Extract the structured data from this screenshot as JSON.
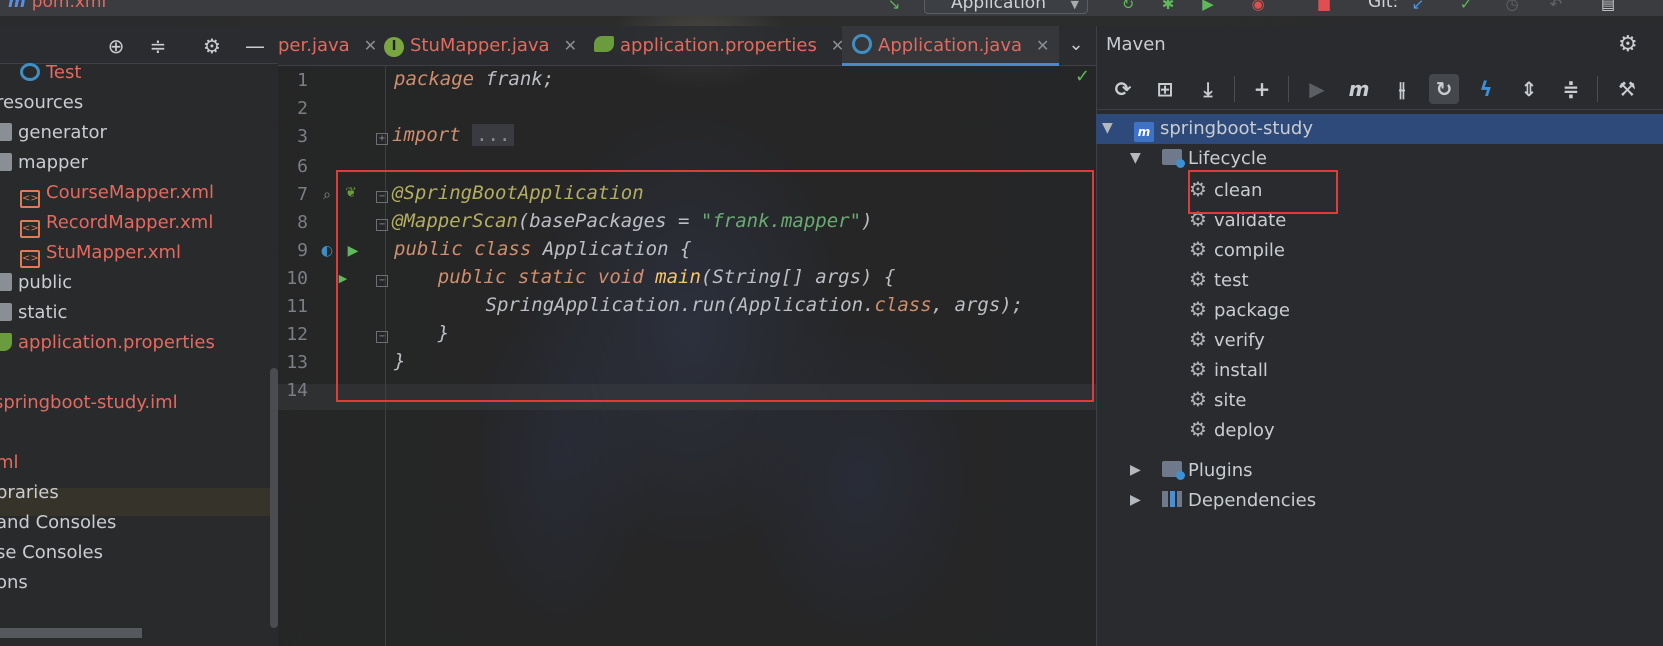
{
  "topbar": {
    "file_name": "pom.xml",
    "run_config": "Application",
    "git_label": "Git:"
  },
  "project": {
    "items": [
      {
        "label": "Test",
        "color": "red"
      },
      {
        "label": "resources",
        "color": "plain"
      },
      {
        "label": "generator",
        "color": "plain"
      },
      {
        "label": "mapper",
        "color": "plain"
      },
      {
        "label": "CourseMapper.xml",
        "color": "red"
      },
      {
        "label": "RecordMapper.xml",
        "color": "red"
      },
      {
        "label": "StuMapper.xml",
        "color": "red"
      },
      {
        "label": "public",
        "color": "plain"
      },
      {
        "label": "static",
        "color": "plain"
      },
      {
        "label": "application.properties",
        "color": "red"
      },
      {
        "label": "springboot-study.iml",
        "color": "red"
      },
      {
        "label": "ml",
        "color": "red"
      },
      {
        "label": "braries",
        "color": "plain"
      },
      {
        "label": "and Consoles",
        "color": "plain"
      },
      {
        "label": "se Consoles",
        "color": "plain"
      },
      {
        "label": "ons",
        "color": "plain"
      }
    ]
  },
  "tabs": [
    {
      "label": "per.java"
    },
    {
      "label": "StuMapper.java"
    },
    {
      "label": "application.properties"
    },
    {
      "label": "Application.java"
    }
  ],
  "editor": {
    "line_numbers": [
      "1",
      "2",
      "3",
      "6",
      "7",
      "8",
      "9",
      "10",
      "11",
      "12",
      "13",
      "14"
    ],
    "line1": {
      "kw": "package",
      "rest": " frank;"
    },
    "line3": {
      "kw": "import",
      "ellipsis": "..."
    },
    "line7": {
      "ann": "@SpringBootApplication"
    },
    "line8": {
      "ann": "@MapperScan",
      "open": "(",
      "param": "basePackages",
      "eq": " = ",
      "str": "\"frank.mapper\"",
      "close": ")"
    },
    "line9": {
      "kw": "public class",
      "rest": " Application {"
    },
    "line10": {
      "kw": "public static void",
      "meth": "main",
      "rest": "(String[] args) {"
    },
    "line11": {
      "pre": "SpringApplication.run(Application.",
      "kw": "class",
      "rest": ", args);"
    },
    "line12": {
      "text": "}"
    },
    "line13": {
      "text": "}"
    }
  },
  "maven": {
    "title": "Maven",
    "project": "springboot-study",
    "lifecycle": "Lifecycle",
    "goals": [
      "clean",
      "validate",
      "compile",
      "test",
      "package",
      "verify",
      "install",
      "site",
      "deploy"
    ],
    "plugins": "Plugins",
    "dependencies": "Dependencies",
    "toolbar_icons": [
      "reload-icon",
      "add-folder-icon",
      "download-icon",
      "plus-icon",
      "run-icon",
      "maven-m-icon",
      "toggle-offline-icon",
      "skip-tests-icon",
      "lightning-icon",
      "expand-all-icon",
      "collapse-all-icon",
      "wrench-icon"
    ]
  },
  "colors": {
    "highlight_box": "#e03b3b",
    "selection": "#2e4a7a",
    "accent": "#4a88c7"
  }
}
